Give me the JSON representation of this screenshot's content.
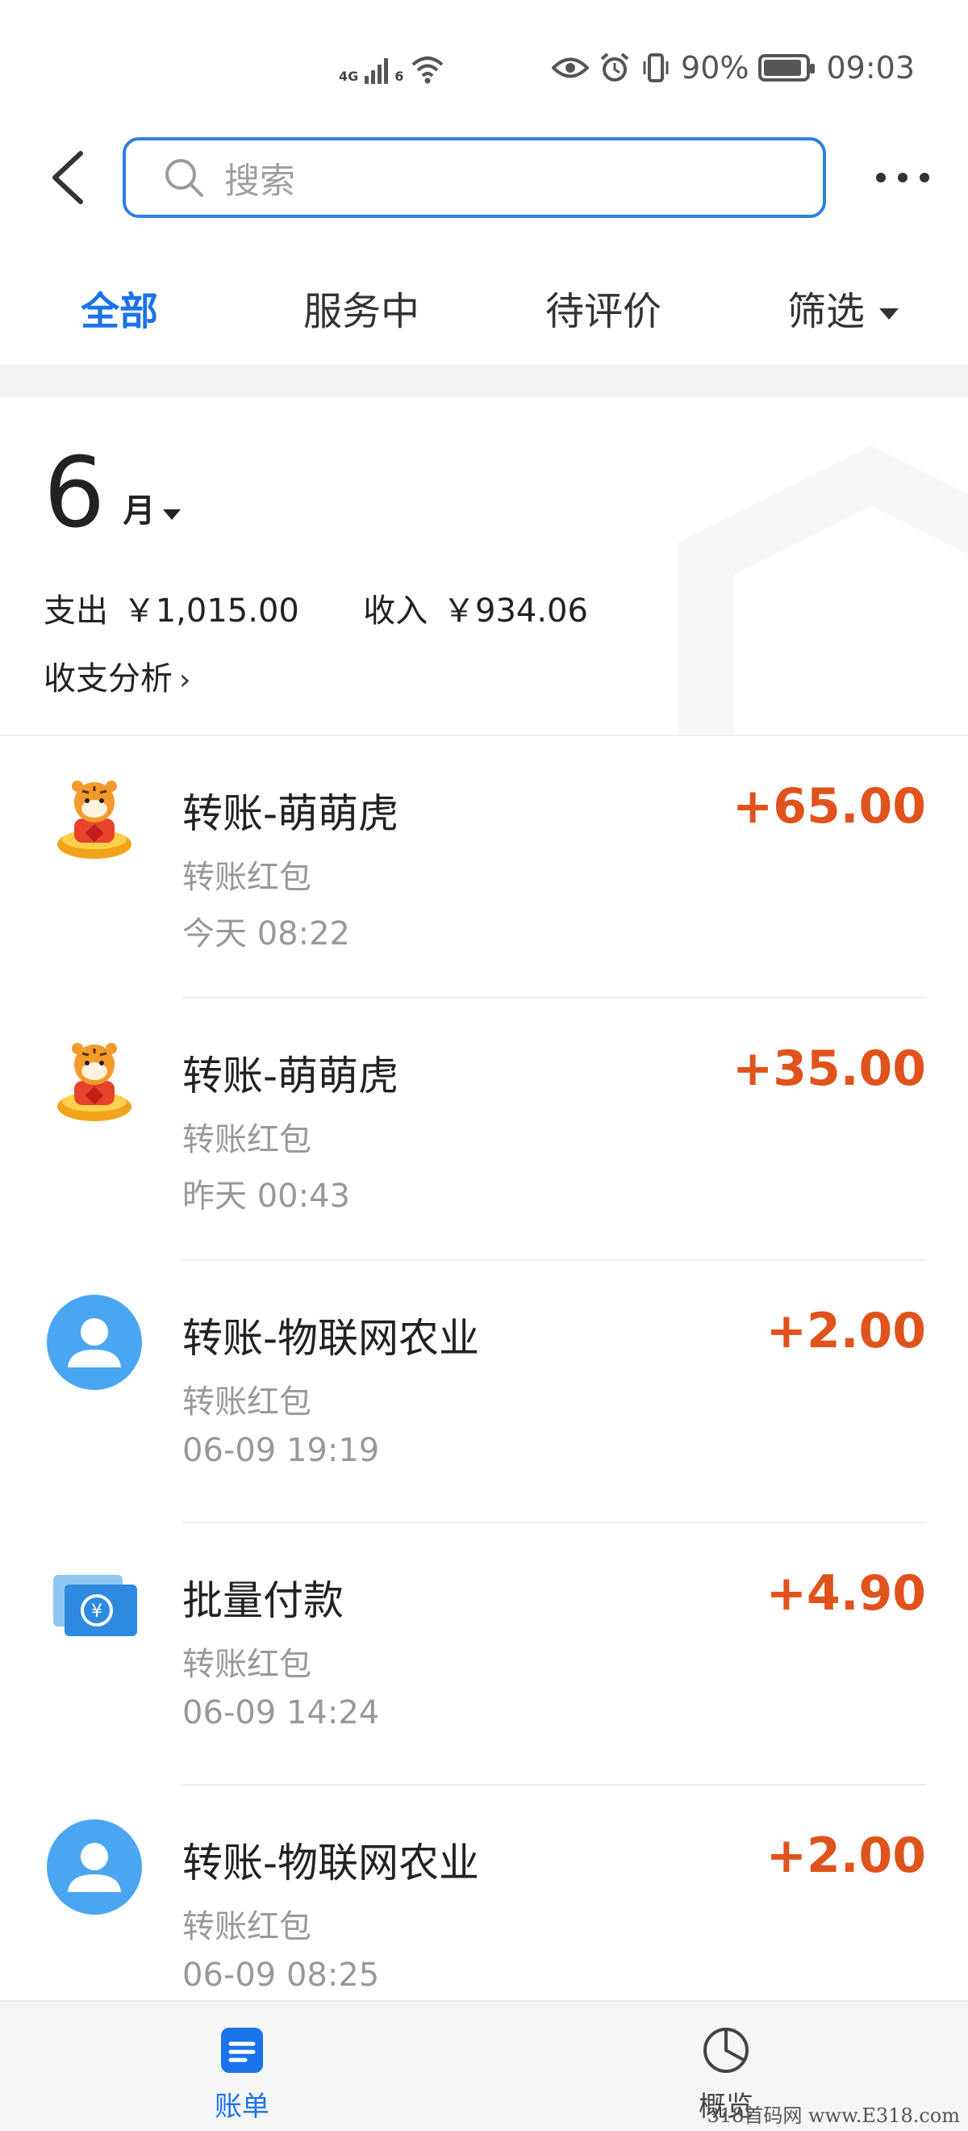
{
  "status_bar": {
    "network": "4G",
    "wifi_label": "6",
    "battery": "90%",
    "time": "09:03"
  },
  "search": {
    "placeholder": "搜索"
  },
  "tabs": [
    {
      "label": "全部",
      "active": true
    },
    {
      "label": "服务中",
      "active": false
    },
    {
      "label": "待评价",
      "active": false
    },
    {
      "label": "筛选",
      "active": false
    }
  ],
  "summary": {
    "month_number": "6",
    "month_unit": "月",
    "expense_label": "支出",
    "expense_value": "￥1,015.00",
    "income_label": "收入",
    "income_value": "￥934.06",
    "analysis_label": "收支分析"
  },
  "transactions": [
    {
      "icon": "tiger-avatar",
      "title": "转账-萌萌虎",
      "subtitle": "转账红包",
      "time": "今天  08:22",
      "amount": "+65.00"
    },
    {
      "icon": "tiger-avatar",
      "title": "转账-萌萌虎",
      "subtitle": "转账红包",
      "time": "昨天  00:43",
      "amount": "+35.00"
    },
    {
      "icon": "person-avatar",
      "title": "转账-物联网农业",
      "subtitle": "转账红包",
      "time": "06-09  19:19",
      "amount": "+2.00"
    },
    {
      "icon": "batch-payment-icon",
      "title": "批量付款",
      "subtitle": "转账红包",
      "time": "06-09  14:24",
      "amount": "+4.90"
    },
    {
      "icon": "person-avatar",
      "title": "转账-物联网农业",
      "subtitle": "转账红包",
      "time": "06-09  08:25",
      "amount": "+2.00"
    }
  ],
  "bottom_nav": [
    {
      "label": "账单",
      "active": true
    },
    {
      "label": "概览",
      "active": false
    }
  ],
  "watermark": "318首码网  www.E318.com",
  "colors": {
    "accent": "#1a73e8",
    "amount": "#e0531c",
    "person_avatar": "#4aa6f3"
  }
}
